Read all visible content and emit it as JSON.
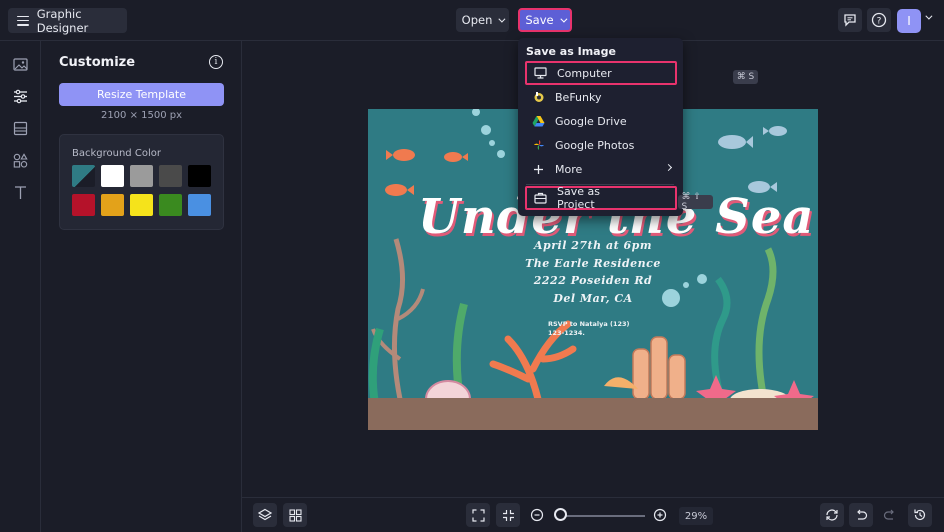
{
  "header": {
    "app_title": "Graphic Designer",
    "open_label": "Open",
    "save_label": "Save",
    "avatar_initial": "I"
  },
  "panel": {
    "title": "Customize",
    "resize_label": "Resize Template",
    "dimensions": "2100 × 1500 px",
    "bg_color_label": "Background Color",
    "swatches": [
      "#2f7b84",
      "#ffffff",
      "#9b9b9b",
      "#4a4a4a",
      "#000000",
      "#b5122a",
      "#e3a21a",
      "#f5e31b",
      "#3a8a1f",
      "#4a90e2"
    ]
  },
  "dropdown": {
    "header": "Save as Image",
    "items": [
      {
        "label": "Computer",
        "shortcut": "⌘ S"
      },
      {
        "label": "BeFunky"
      },
      {
        "label": "Google Drive"
      },
      {
        "label": "Google Photos"
      },
      {
        "label": "More"
      },
      {
        "label": "Save as Project",
        "shortcut": "⌘ ⇧ S"
      }
    ]
  },
  "canvas": {
    "title": "Under the Sea",
    "details": [
      "April 27th at 6pm",
      "The Earle Residence",
      "2222 Poseiden Rd",
      "Del Mar, CA"
    ],
    "rsvp_line1": "RSVP to Natalya (123)",
    "rsvp_line2": "123-1234."
  },
  "bottombar": {
    "zoom": "29%"
  }
}
